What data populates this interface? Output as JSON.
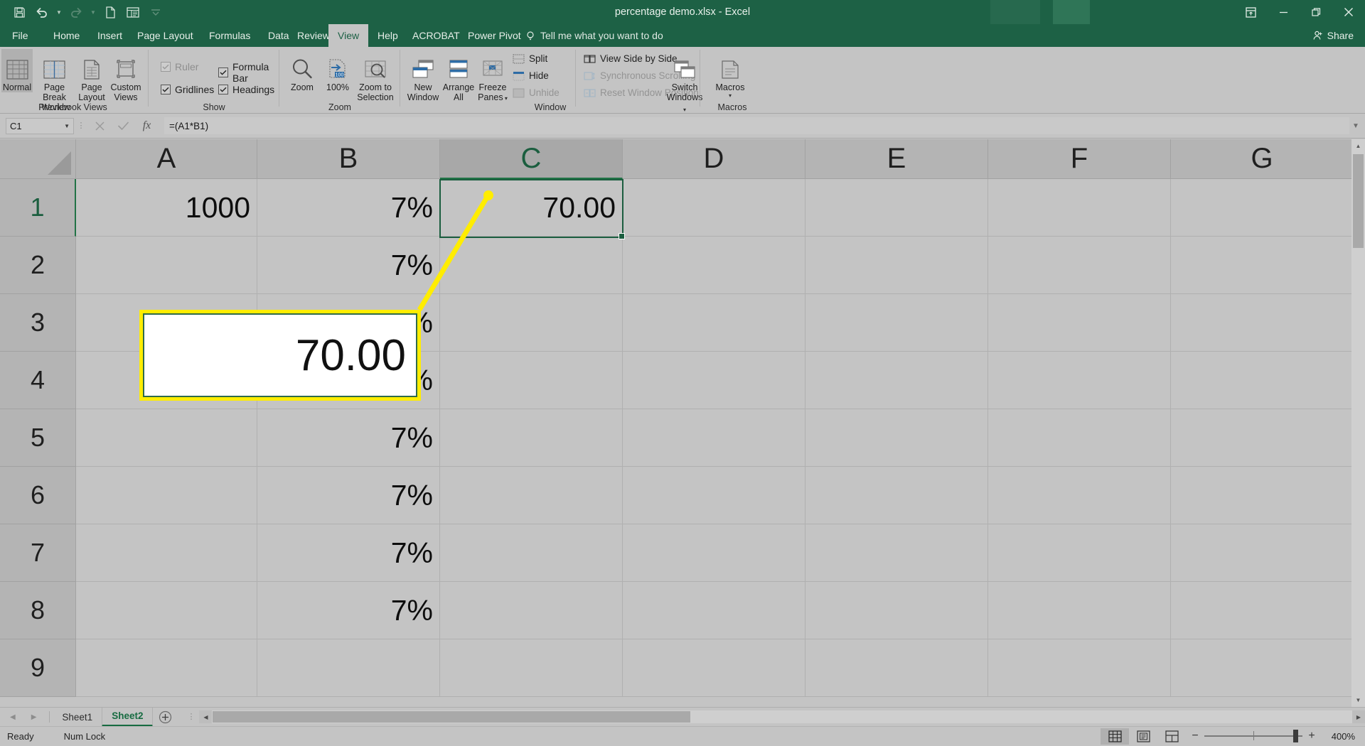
{
  "titlebar": {
    "title": "percentage demo.xlsx  -  Excel",
    "quick_access": [
      {
        "name": "save-icon",
        "label": "Save"
      },
      {
        "name": "undo-icon",
        "label": "Undo"
      },
      {
        "name": "redo-icon",
        "label": "Redo"
      },
      {
        "name": "new-icon",
        "label": "New"
      },
      {
        "name": "touch-mode-icon",
        "label": "Touch/Mouse Mode"
      },
      {
        "name": "customize-qat-icon",
        "label": "Customize Quick Access Toolbar"
      }
    ],
    "window_controls": {
      "ribbon_display": "Ribbon Display Options",
      "minimize": "Minimize",
      "restore": "Restore Down",
      "close": "Close"
    }
  },
  "ribbon_tabs": {
    "items": [
      {
        "label": "File",
        "active": false
      },
      {
        "label": "Home",
        "active": false
      },
      {
        "label": "Insert",
        "active": false
      },
      {
        "label": "Page Layout",
        "active": false
      },
      {
        "label": "Formulas",
        "active": false
      },
      {
        "label": "Data",
        "active": false
      },
      {
        "label": "Review",
        "active": false
      },
      {
        "label": "View",
        "active": true
      },
      {
        "label": "Help",
        "active": false
      },
      {
        "label": "ACROBAT",
        "active": false
      },
      {
        "label": "Power Pivot",
        "active": false
      }
    ],
    "tell_me": "Tell me what you want to do",
    "share": "Share"
  },
  "ribbon": {
    "groups": [
      {
        "name": "workbook-views",
        "label": "Workbook Views"
      },
      {
        "name": "show",
        "label": "Show"
      },
      {
        "name": "zoom",
        "label": "Zoom"
      },
      {
        "name": "window",
        "label": "Window"
      },
      {
        "name": "macros",
        "label": "Macros"
      }
    ],
    "workbook_views": [
      {
        "label": "Normal",
        "selected": true
      },
      {
        "label": "Page Break\nPreview",
        "selected": false
      },
      {
        "label": "Page\nLayout",
        "selected": false
      },
      {
        "label": "Custom\nViews",
        "selected": false
      }
    ],
    "workbook_views_labels": {
      "normal": "Normal",
      "page_break_l1": "Page Break",
      "page_break_l2": "Preview",
      "page_layout_l1": "Page",
      "page_layout_l2": "Layout",
      "custom_l1": "Custom",
      "custom_l2": "Views"
    },
    "show": {
      "ruler": {
        "label": "Ruler",
        "checked": true,
        "enabled": false
      },
      "formula_bar": {
        "label": "Formula Bar",
        "checked": true,
        "enabled": true
      },
      "gridlines": {
        "label": "Gridlines",
        "checked": true,
        "enabled": true
      },
      "headings": {
        "label": "Headings",
        "checked": true,
        "enabled": true
      }
    },
    "zoom_group": {
      "zoom": "Zoom",
      "hundred": "100%",
      "zoom_to_l1": "Zoom to",
      "zoom_to_l2": "Selection"
    },
    "window_group": {
      "new_window_l1": "New",
      "new_window_l2": "Window",
      "arrange_all_l1": "Arrange",
      "arrange_all_l2": "All",
      "freeze_panes_l1": "Freeze",
      "freeze_panes_l2": "Panes",
      "split": "Split",
      "hide": "Hide",
      "unhide": "Unhide",
      "view_side_by_side": "View Side by Side",
      "synchronous_scrolling": "Synchronous Scrolling",
      "reset_window_position": "Reset Window Position",
      "switch_windows_l1": "Switch",
      "switch_windows_l2": "Windows"
    },
    "macros_group": {
      "macros": "Macros"
    }
  },
  "formula_bar": {
    "name_box_value": "C1",
    "cancel_label": "Cancel",
    "enter_label": "Enter",
    "fx_label": "Insert Function",
    "formula_value": "=(A1*B1)",
    "expand_label": "Expand Formula Bar"
  },
  "grid": {
    "columns": [
      "A",
      "B",
      "C",
      "D",
      "E",
      "F",
      "G"
    ],
    "selected_column": "C",
    "rows": [
      "1",
      "2",
      "3",
      "4",
      "5",
      "6",
      "7",
      "8",
      "9"
    ],
    "selected_row": "1",
    "cells": [
      {
        "col": "A",
        "row": "1",
        "value": "1000"
      },
      {
        "col": "B",
        "row": "1",
        "value": "7%"
      },
      {
        "col": "C",
        "row": "1",
        "value": "70.00"
      },
      {
        "col": "B",
        "row": "2",
        "value": "7%"
      },
      {
        "col": "B",
        "row": "3",
        "value": "7%"
      },
      {
        "col": "B",
        "row": "4",
        "value": "7%"
      },
      {
        "col": "B",
        "row": "5",
        "value": "7%"
      },
      {
        "col": "B",
        "row": "6",
        "value": "7%"
      },
      {
        "col": "B",
        "row": "7",
        "value": "7%"
      },
      {
        "col": "B",
        "row": "8",
        "value": "7%"
      }
    ],
    "active_cell": "C1",
    "callout": {
      "text": "70.00",
      "border_color": "#ffed00",
      "inner_border_color": "#2e6b4a"
    }
  },
  "sheet_tabs": {
    "items": [
      {
        "label": "Sheet1",
        "active": false
      },
      {
        "label": "Sheet2",
        "active": true
      }
    ],
    "add_sheet_label": "New sheet",
    "prev_label": "Previous Sheet",
    "next_label": "Next Sheet"
  },
  "status_bar": {
    "mode": "Ready",
    "num_lock": "Num Lock",
    "views": [
      {
        "name": "normal-view-icon",
        "label": "Normal",
        "active": true
      },
      {
        "name": "page-layout-view-icon",
        "label": "Page Layout",
        "active": false
      },
      {
        "name": "page-break-view-icon",
        "label": "Page Break Preview",
        "active": false
      }
    ],
    "zoom_out_label": "Zoom Out",
    "zoom_in_label": "Zoom In",
    "zoom_level": "400%"
  },
  "colors": {
    "excel_green": "#1d6145",
    "accent_green": "#217346",
    "highlight_yellow": "#ffed00",
    "chrome_gray": "#c4c4c4"
  }
}
